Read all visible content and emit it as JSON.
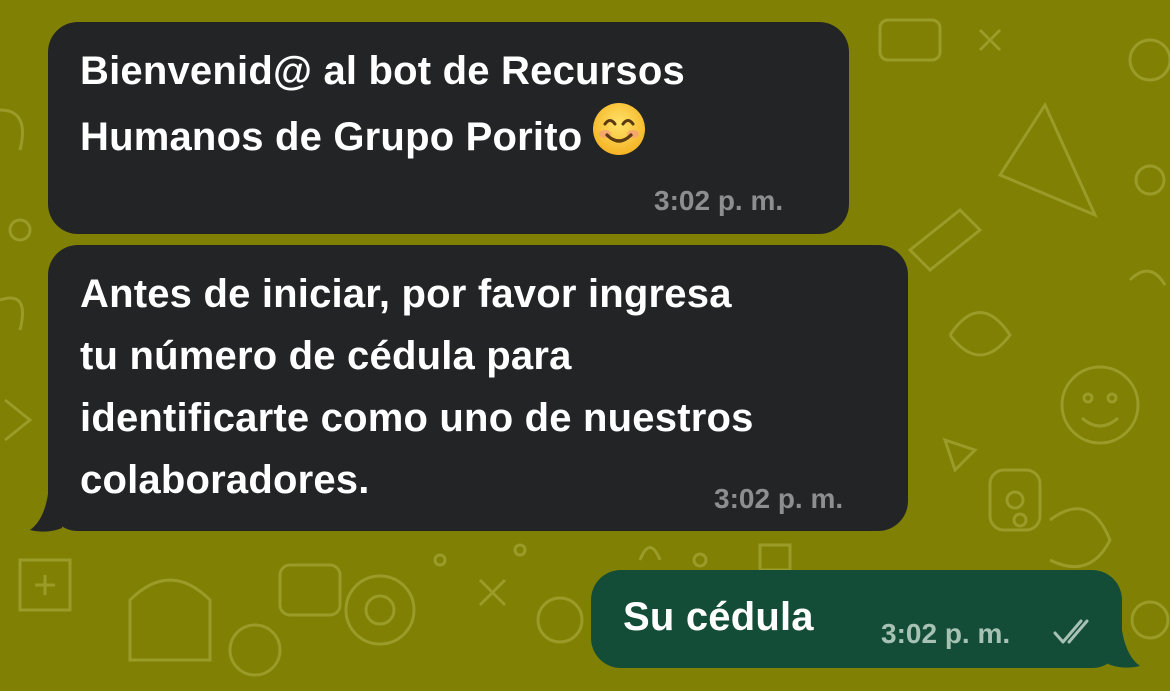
{
  "colors": {
    "wallpaper": "#7f8004",
    "incoming_bubble": "#232426",
    "outgoing_bubble": "#144d37",
    "timestamp_incoming": "#8d8e90",
    "timestamp_outgoing": "#a7c1b5",
    "read_checks": "#a7c1b5"
  },
  "messages": [
    {
      "direction": "incoming",
      "lines": [
        "Bienvenid@ al bot de Recursos",
        "Humanos de Grupo Porito"
      ],
      "emoji": "smiling-face-icon",
      "time": "3:02 p. m."
    },
    {
      "direction": "incoming",
      "lines": [
        "Antes de iniciar, por favor ingresa",
        "tu número de cédula para",
        "identificarte como uno de nuestros",
        "colaboradores."
      ],
      "time": "3:02 p. m."
    },
    {
      "direction": "outgoing",
      "lines": [
        "Su cédula"
      ],
      "time": "3:02 p. m.",
      "status_icon": "double-check-icon"
    }
  ]
}
